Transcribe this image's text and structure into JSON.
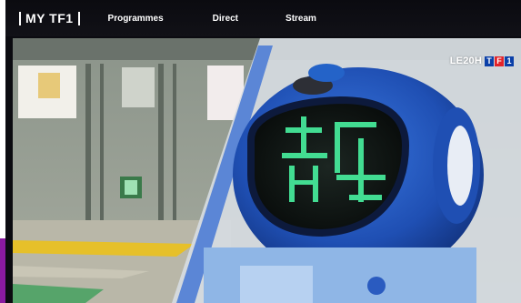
{
  "header": {
    "logo_text": "MY TF1",
    "nav": [
      {
        "label": "Programmes"
      },
      {
        "label": "Direct"
      },
      {
        "label": "Stream"
      }
    ]
  },
  "player": {
    "program_logo": "LE20H",
    "channel_letters": [
      "T",
      "F",
      "1"
    ],
    "screen_glyph": "歩",
    "colors": {
      "led_green": "#48f2a0",
      "robot_blue": "#1f4fb3",
      "accent_purple": "#8a1aa0"
    }
  }
}
